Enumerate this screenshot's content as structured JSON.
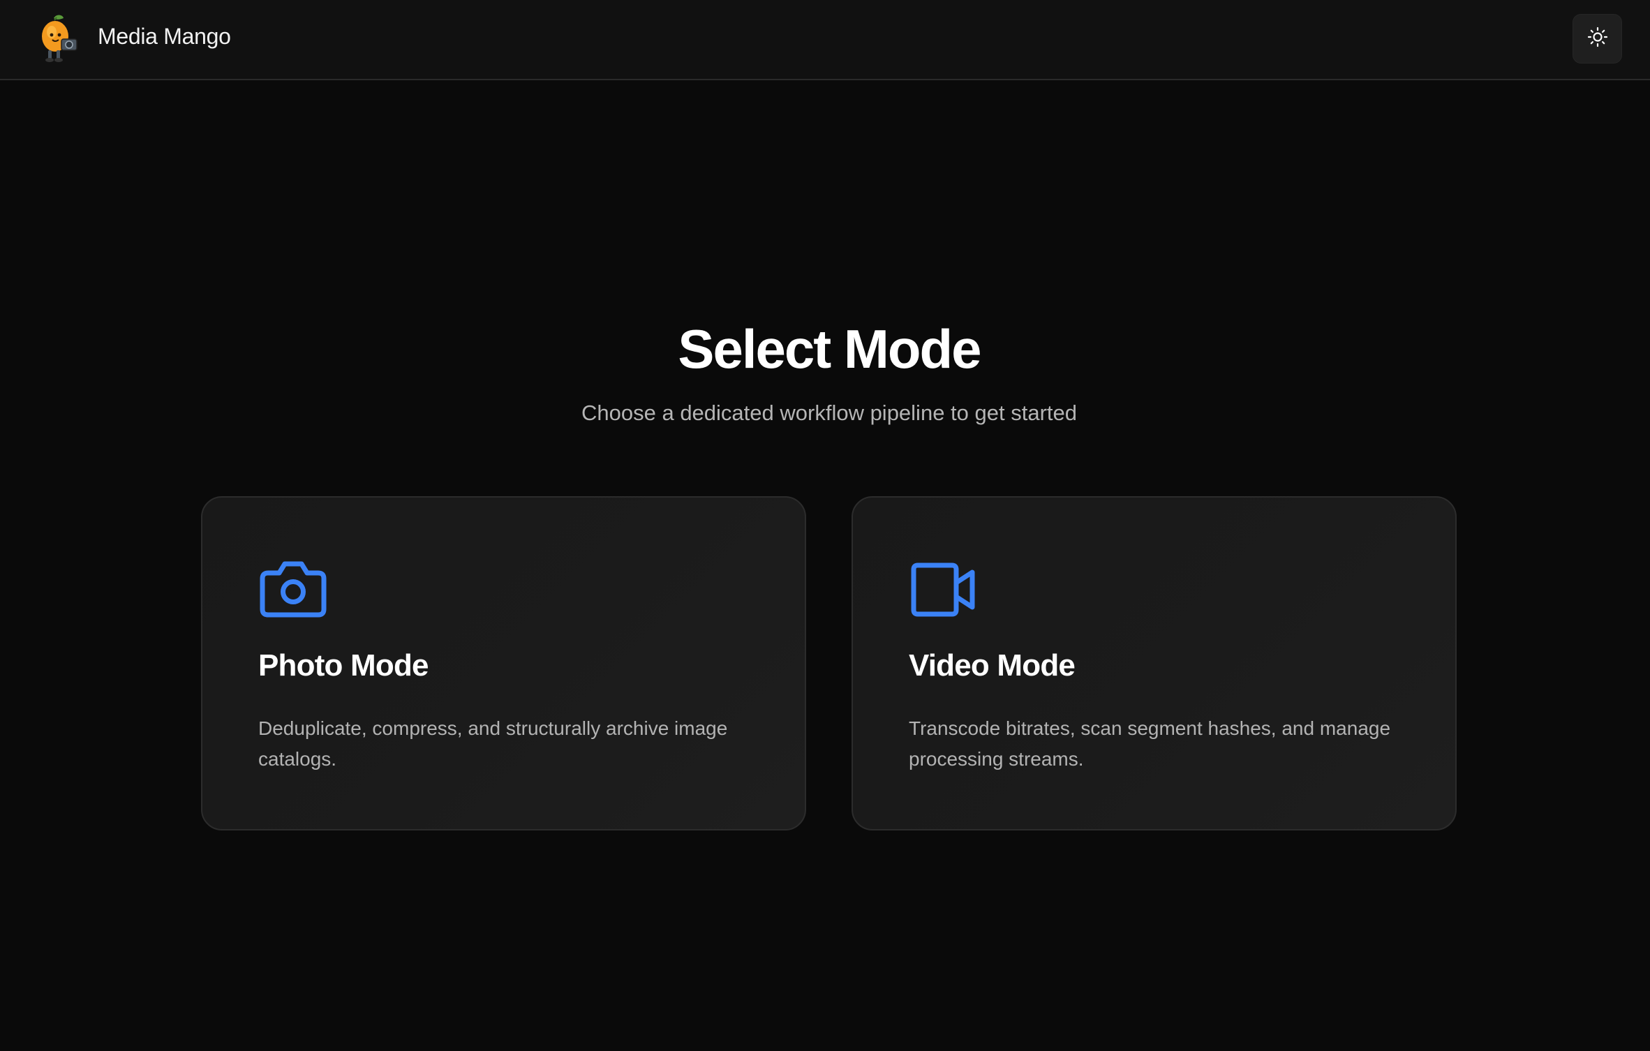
{
  "app": {
    "title": "Media Mango",
    "logo_icon": "mango-mascot-icon"
  },
  "header": {
    "theme_toggle_icon": "sun-icon"
  },
  "main": {
    "title": "Select Mode",
    "subtitle": "Choose a dedicated workflow pipeline to get started"
  },
  "modes": [
    {
      "icon": "camera-icon",
      "title": "Photo Mode",
      "description": "Deduplicate, compress, and structurally archive image catalogs."
    },
    {
      "icon": "video-camera-icon",
      "title": "Video Mode",
      "description": "Transcode bitrates, scan segment hashes, and manage processing streams."
    }
  ],
  "colors": {
    "background": "#0a0a0a",
    "header": "#111111",
    "card": "#1b1b1b",
    "accent": "#3b82f6",
    "mango": "#f39a1f"
  }
}
